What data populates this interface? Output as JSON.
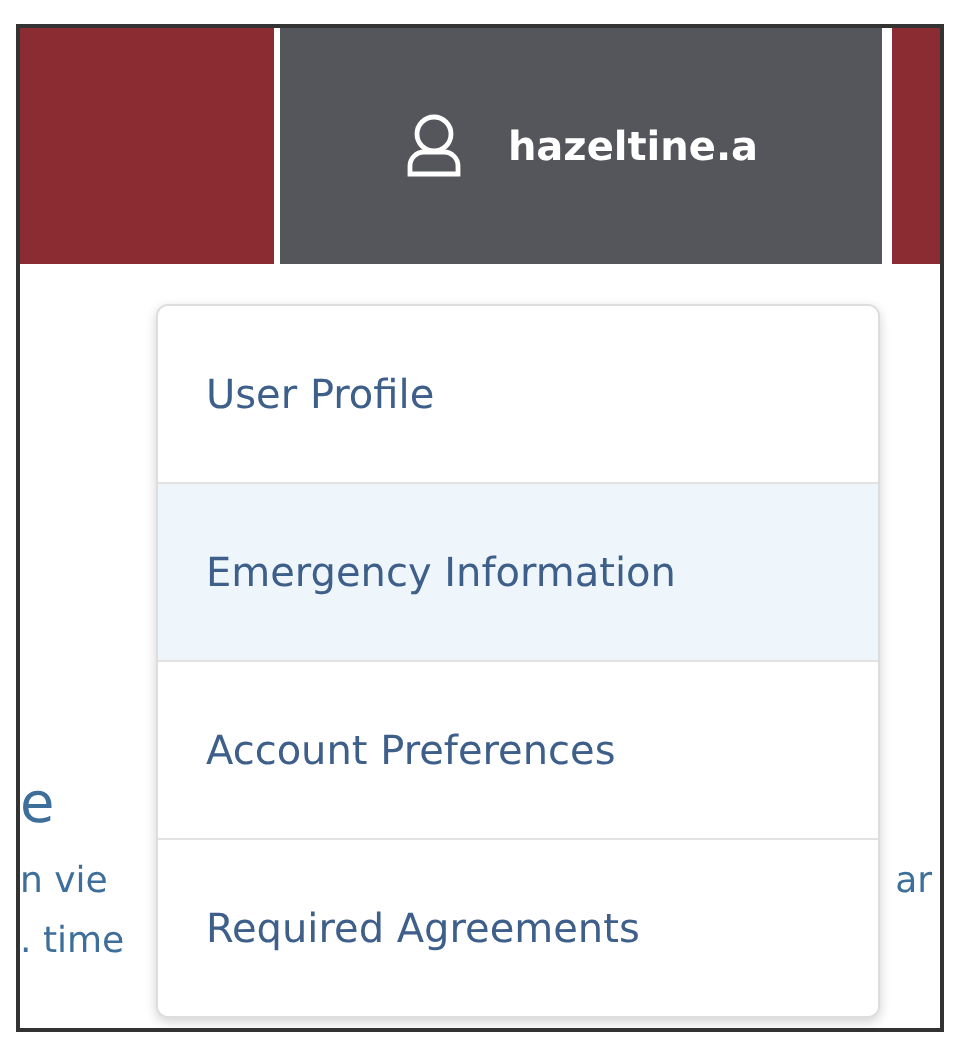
{
  "header": {
    "user_button": {
      "label": "hazeltine.a"
    }
  },
  "background_text": {
    "heading_fragment": "e",
    "left_lines": [
      "n vie",
      ". time"
    ],
    "right_lines": [
      "ar"
    ]
  },
  "user_menu": [
    {
      "label": "User Profile",
      "selected": false
    },
    {
      "label": "Emergency Information",
      "selected": true
    },
    {
      "label": "Account Preferences",
      "selected": false
    },
    {
      "label": "Required Agreements",
      "selected": false
    }
  ]
}
